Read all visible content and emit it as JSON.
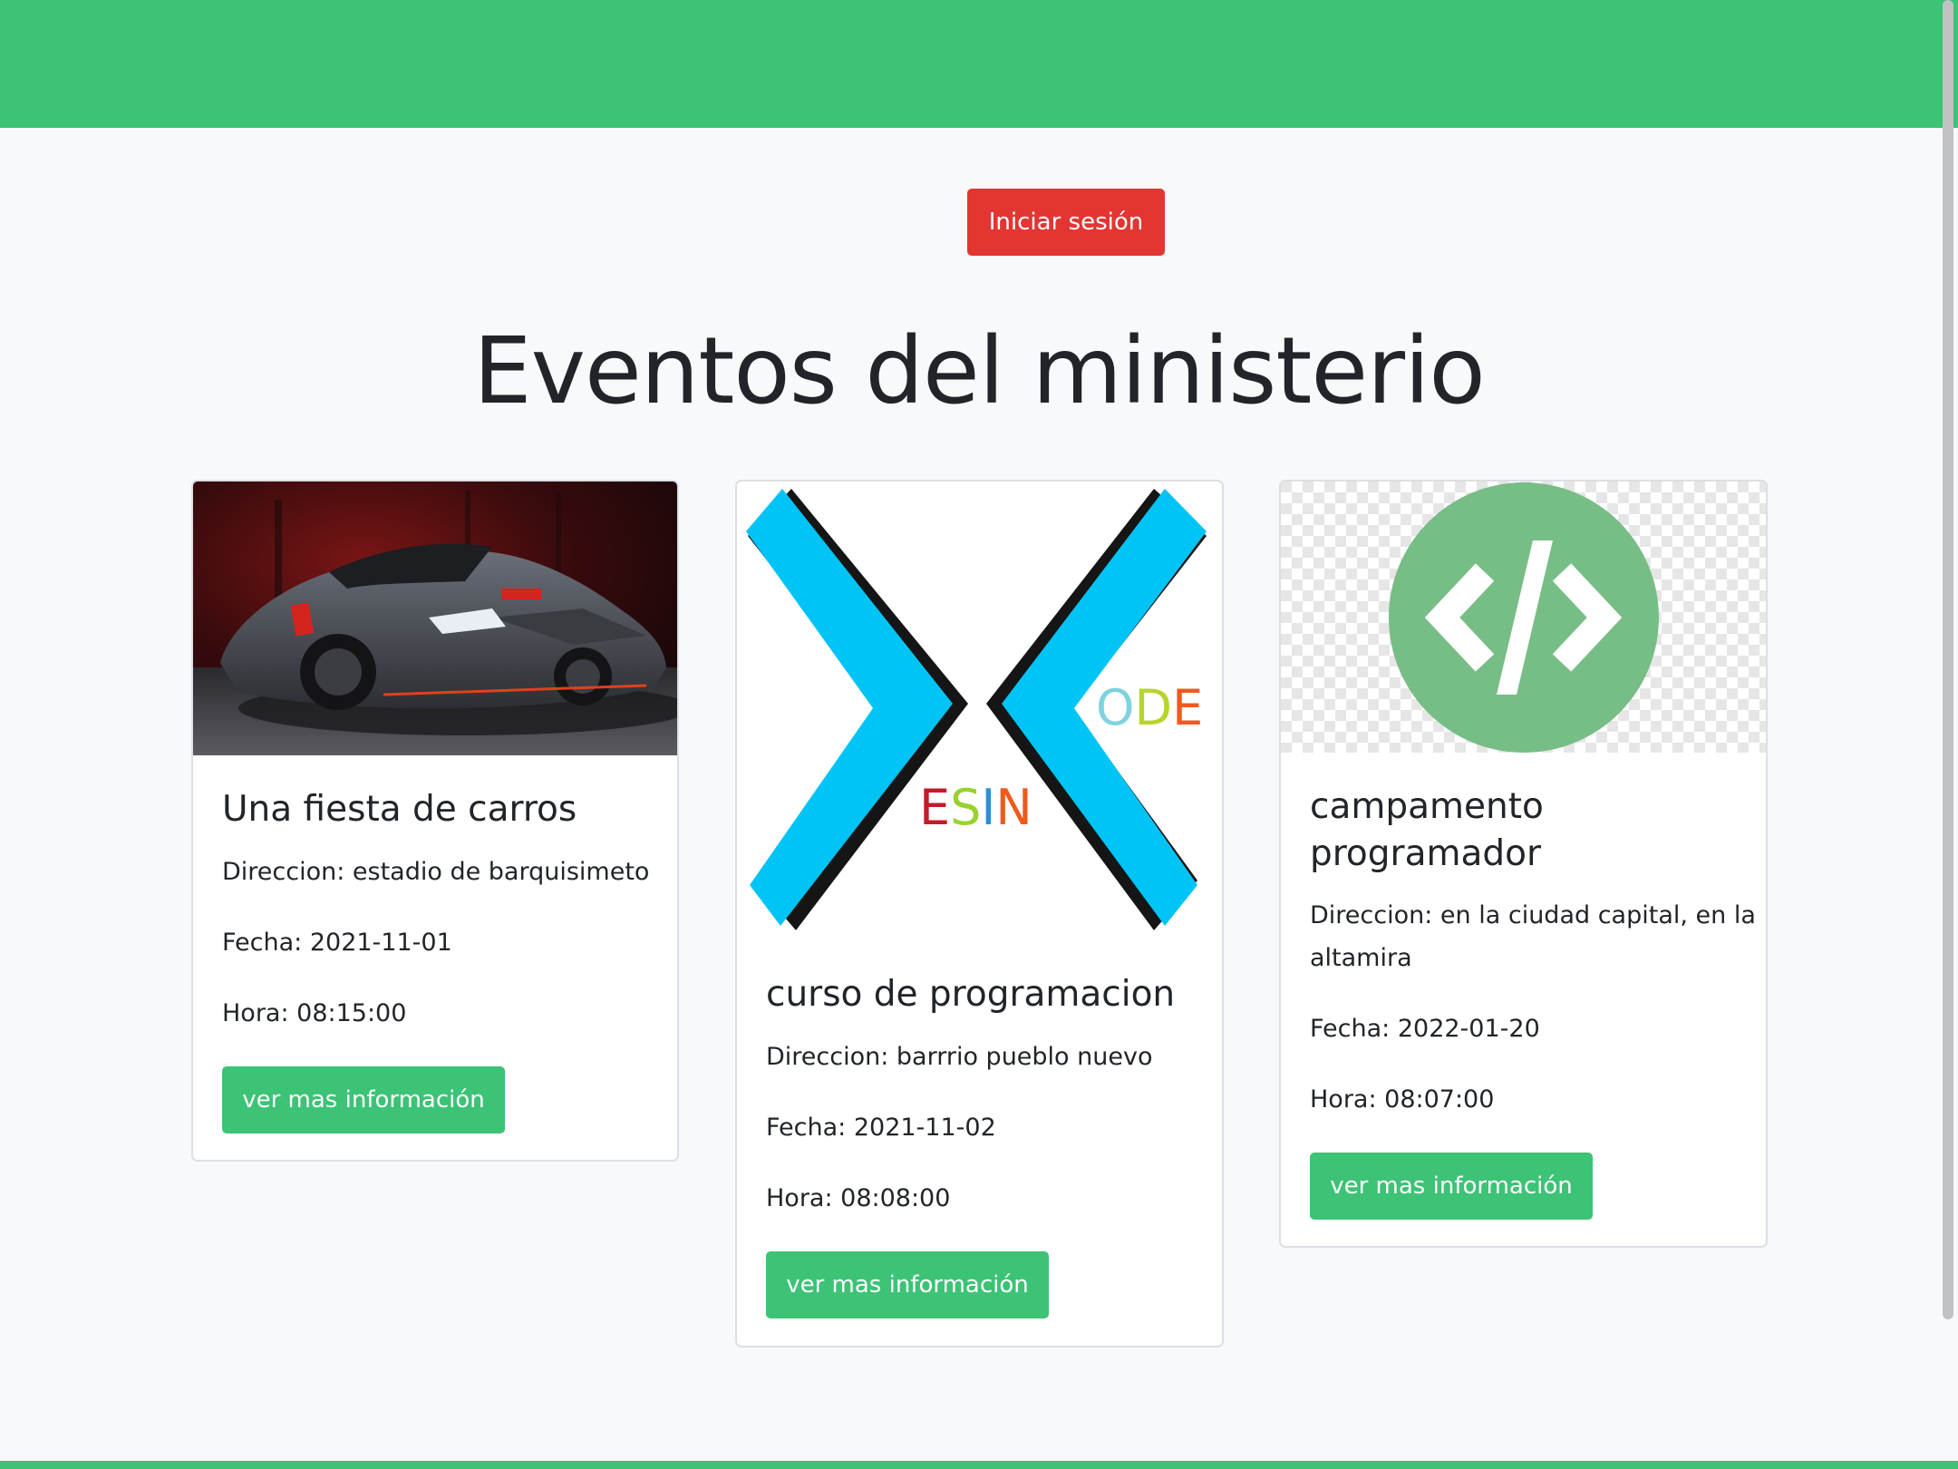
{
  "header": {
    "login_label": "Iniciar sesión"
  },
  "page": {
    "title": "Eventos del ministerio"
  },
  "events": [
    {
      "title": "Una fiesta de carros",
      "direccion": "Direccion: estadio de barquisimeto",
      "fecha": "Fecha: 2021-11-01",
      "hora": "Hora: 08:15:00",
      "button": "ver mas información",
      "image": "sports-car-photo"
    },
    {
      "title": "curso de programacion",
      "direccion": "Direccion: barrrio pueblo nuevo",
      "fecha": "Fecha: 2021-11-02",
      "hora": "Hora: 08:08:00",
      "button": "ver mas información",
      "image": "design-code-logo",
      "logo_text": {
        "left": "ESIN",
        "right": "ODE"
      }
    },
    {
      "title_line1": "campamento",
      "title_line2": "programador",
      "direccion_line1": "Direccion: en la ciudad capital, en la",
      "direccion_line2": "altamira",
      "fecha": "Fecha: 2022-01-20",
      "hora": "Hora: 08:07:00",
      "button": "ver mas información",
      "image": "code-icon-logo"
    }
  ],
  "colors": {
    "primary": "#3cc375",
    "danger": "#e33532",
    "background": "#f8f9fa"
  }
}
